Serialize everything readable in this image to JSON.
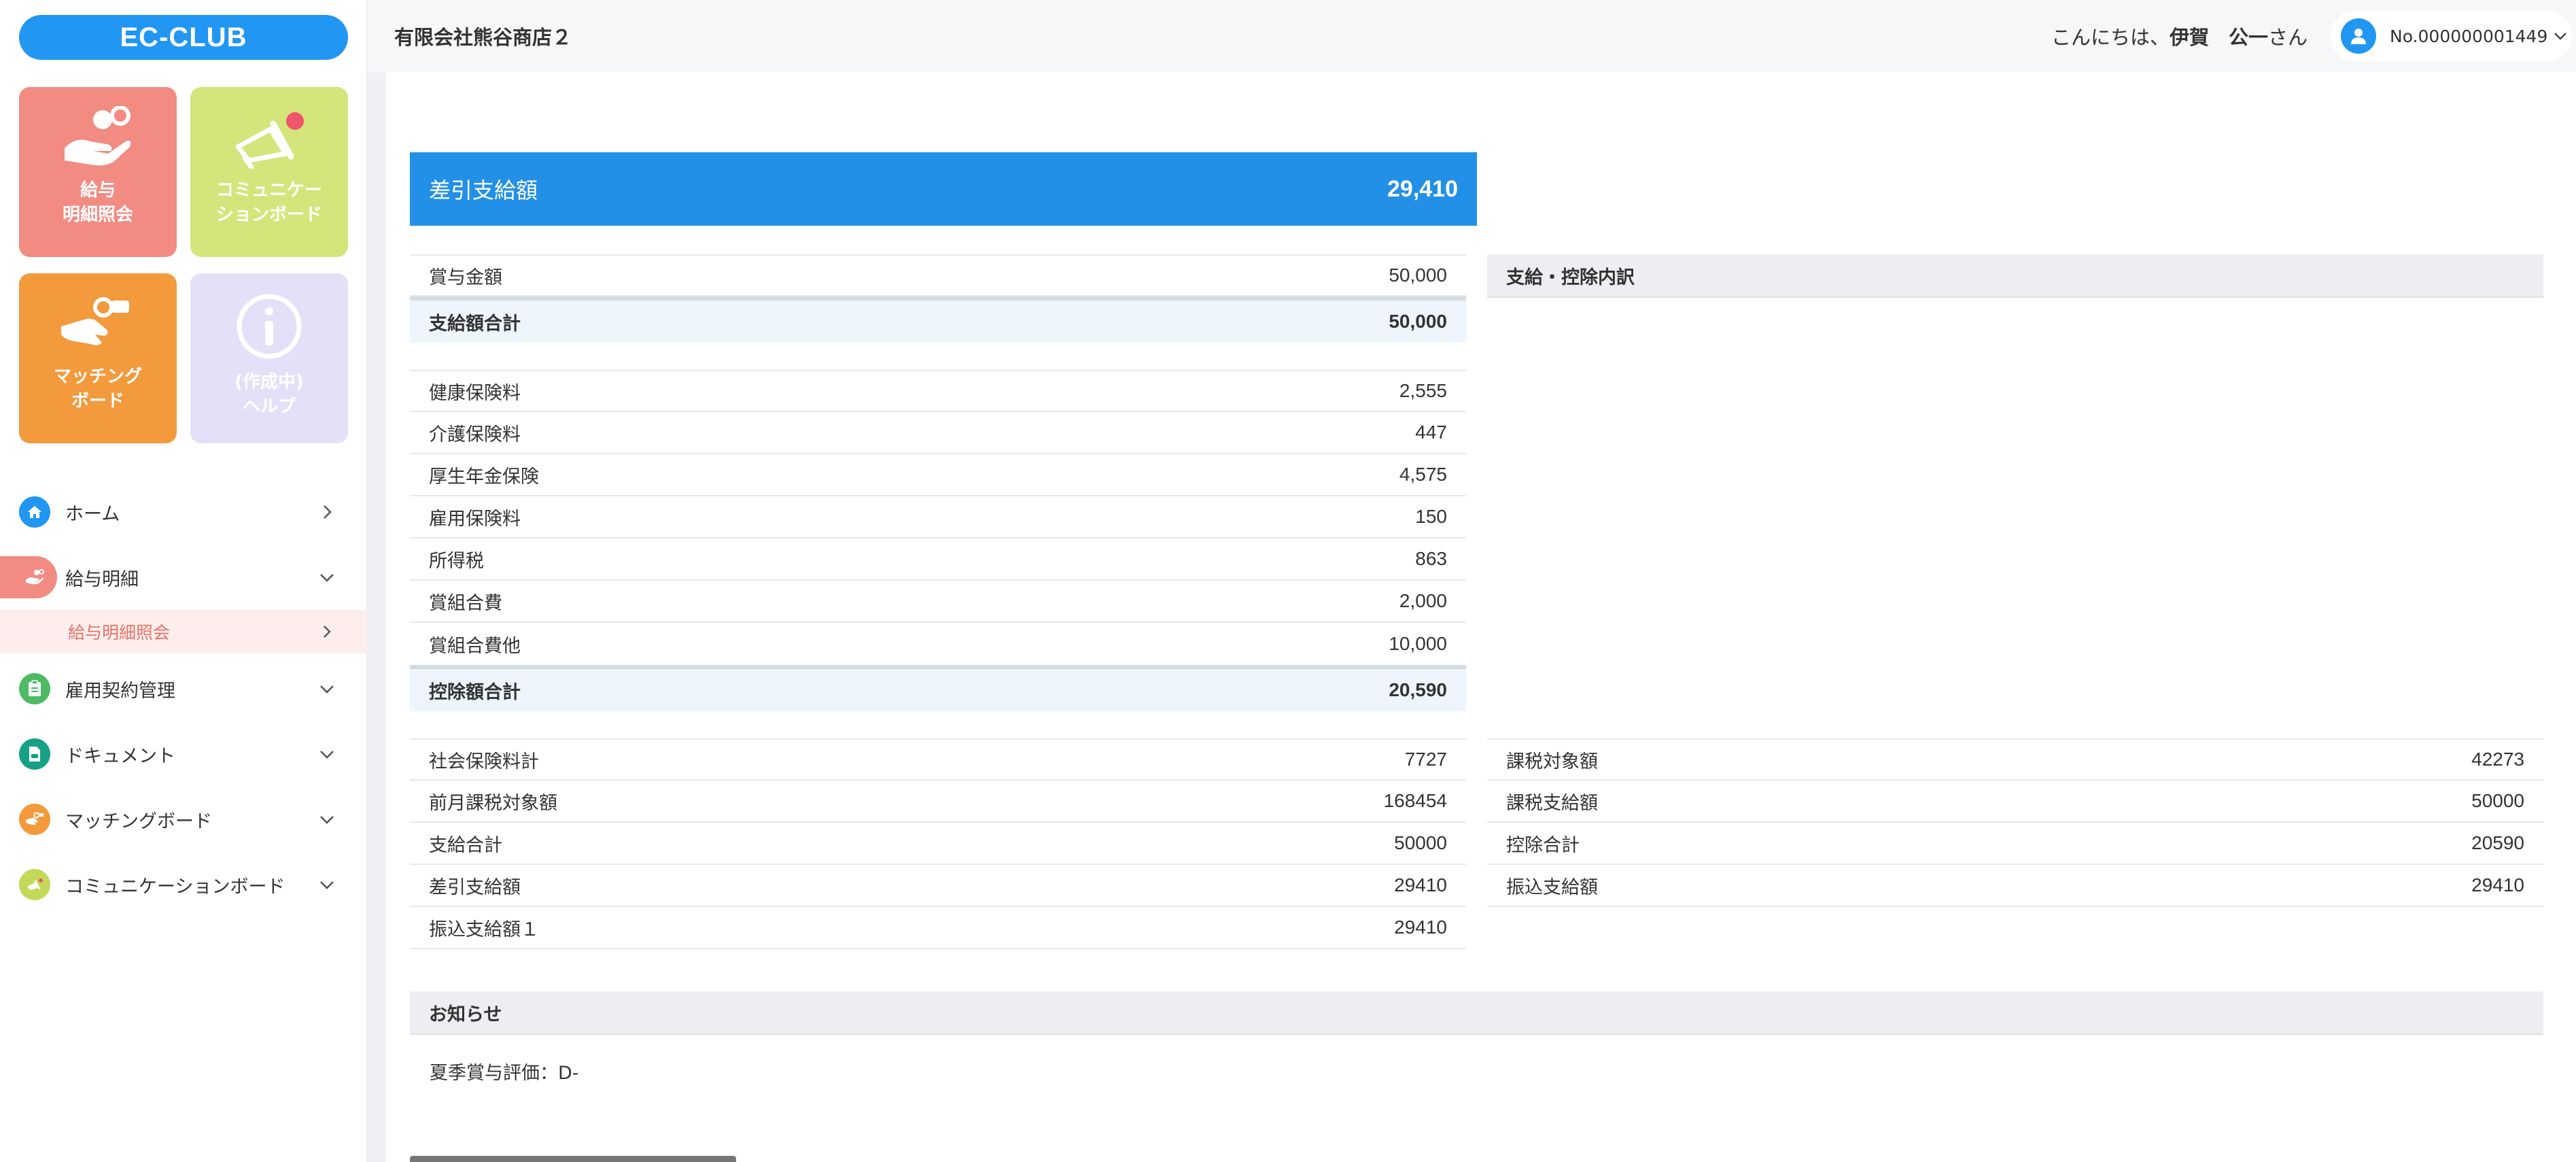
{
  "sidebar": {
    "logo": "EC-CLUB",
    "tiles": {
      "salary": {
        "line1": "給与",
        "line2": "明細照会"
      },
      "communication": {
        "line1": "コミュニケー",
        "line2": "ションボード"
      },
      "matching": {
        "line1": "マッチング",
        "line2": "ボード"
      },
      "help": {
        "line1": "(作成中)",
        "line2": "ヘルプ"
      }
    },
    "nav": {
      "home": "ホーム",
      "payslip": "給与明細",
      "payslip_sub": "給与明細照会",
      "employment": "雇用契約管理",
      "documents": "ドキュメント",
      "matching": "マッチングボード",
      "communication": "コミュニケーションボード"
    }
  },
  "header": {
    "company": "有限会社熊谷商店２",
    "greeting_prefix": "こんにちは、",
    "user_name": "伊賀　公一",
    "greeting_suffix": "さん",
    "account_no": "No.000000001449"
  },
  "net_pay": {
    "label": "差引支給額",
    "value": "29,410"
  },
  "payments": {
    "rows": [
      {
        "label": "賞与金額",
        "value": "50,000"
      }
    ],
    "total": {
      "label": "支給額合計",
      "value": "50,000"
    }
  },
  "deductions": {
    "rows": [
      {
        "label": "健康保険料",
        "value": "2,555"
      },
      {
        "label": "介護保険料",
        "value": "447"
      },
      {
        "label": "厚生年金保険",
        "value": "4,575"
      },
      {
        "label": "雇用保険料",
        "value": "150"
      },
      {
        "label": "所得税",
        "value": "863"
      },
      {
        "label": "賞組合費",
        "value": "2,000"
      },
      {
        "label": "賞組合費他",
        "value": "10,000"
      }
    ],
    "total": {
      "label": "控除額合計",
      "value": "20,590"
    }
  },
  "breakdown_title": "支給・控除内訳",
  "summary_left": [
    {
      "label": "社会保険料計",
      "value": "7727"
    },
    {
      "label": "前月課税対象額",
      "value": "168454"
    },
    {
      "label": "支給合計",
      "value": "50000"
    },
    {
      "label": "差引支給額",
      "value": "29410"
    },
    {
      "label": "振込支給額１",
      "value": "29410"
    }
  ],
  "summary_right": [
    {
      "label": "課税対象額",
      "value": "42273"
    },
    {
      "label": "課税支給額",
      "value": "50000"
    },
    {
      "label": "控除合計",
      "value": "20590"
    },
    {
      "label": "振込支給額",
      "value": "29410"
    }
  ],
  "notice": {
    "title": "お知らせ",
    "text": "夏季賞与評価：D-"
  },
  "colors": {
    "brand": "#2196f3",
    "salary_tile": "#f28b82",
    "communication_tile": "#d4e57c",
    "matching_tile": "#f39a3d",
    "help_tile": "#e3e1f7"
  }
}
